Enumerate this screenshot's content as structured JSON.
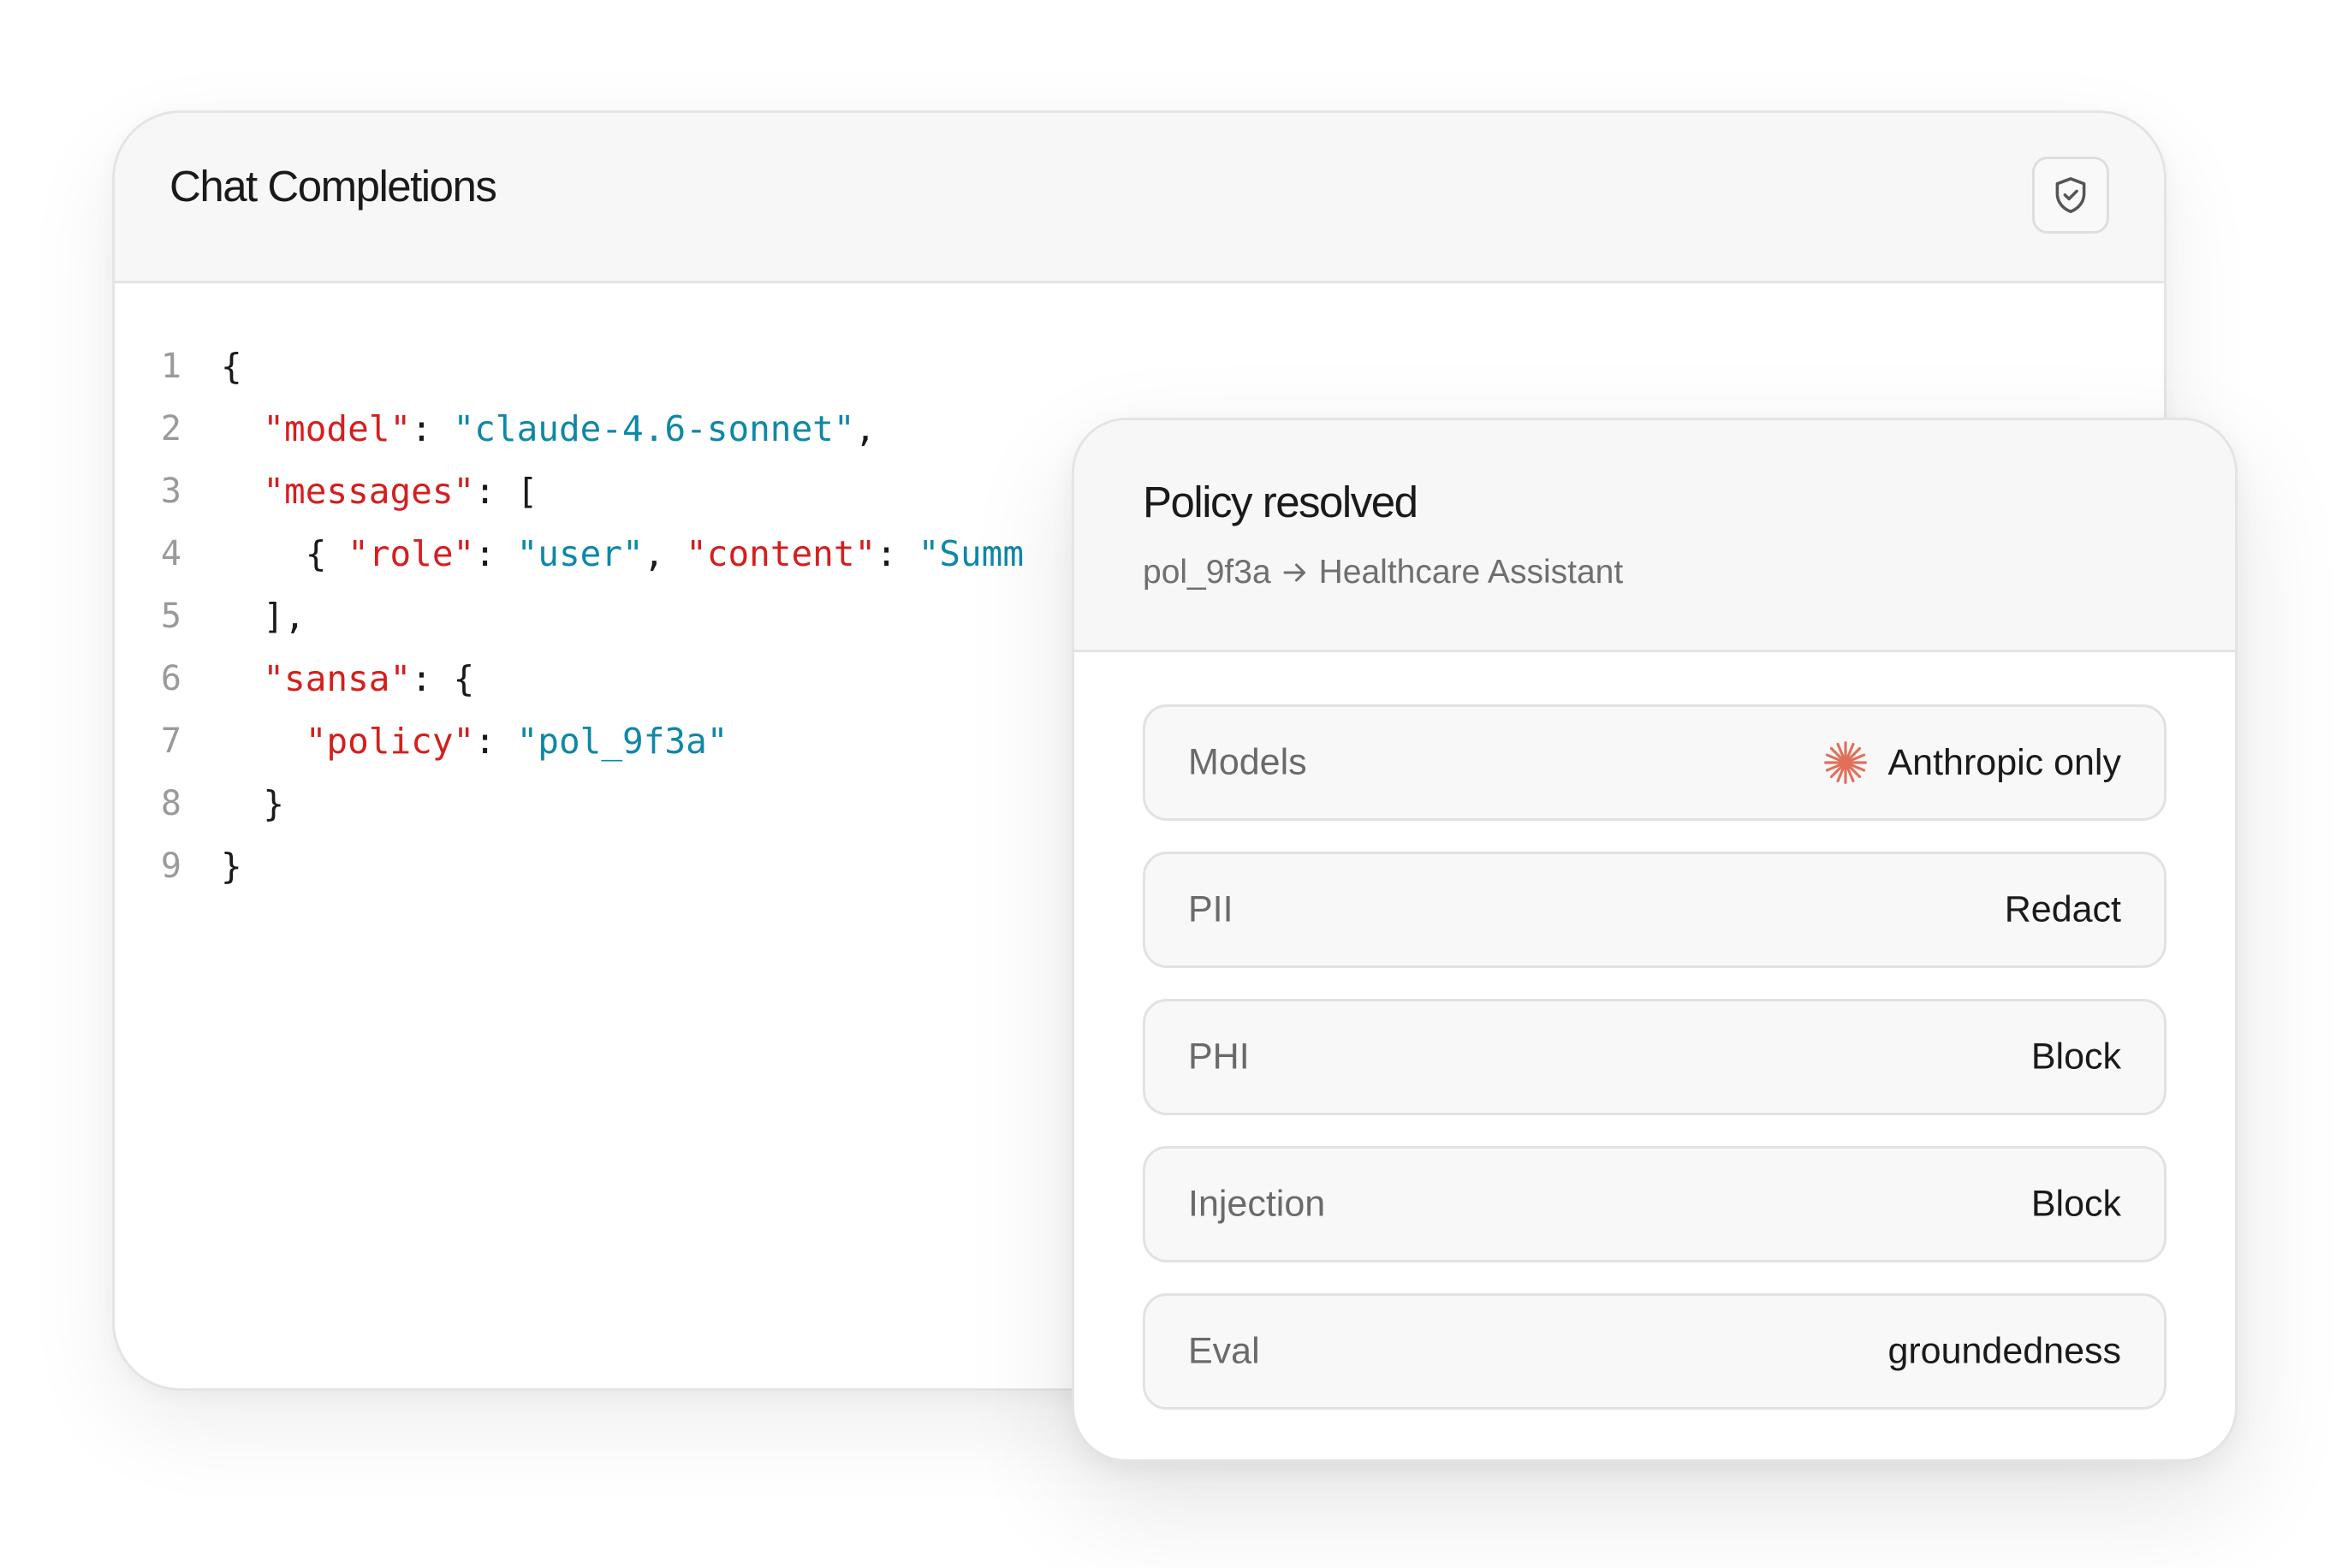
{
  "chat": {
    "title": "Chat Completions",
    "icon": "shield-check-icon",
    "code": {
      "line_numbers": [
        "1",
        "2",
        "3",
        "4",
        "5",
        "6",
        "7",
        "8",
        "9"
      ],
      "lines": [
        [
          {
            "t": "{",
            "k": "punc"
          }
        ],
        [
          {
            "t": "  ",
            "k": "punc"
          },
          {
            "t": "\"model\"",
            "k": "key"
          },
          {
            "t": ": ",
            "k": "punc"
          },
          {
            "t": "\"claude-4.6-sonnet\"",
            "k": "str"
          },
          {
            "t": ",",
            "k": "punc"
          }
        ],
        [
          {
            "t": "  ",
            "k": "punc"
          },
          {
            "t": "\"messages\"",
            "k": "key"
          },
          {
            "t": ": [",
            "k": "punc"
          }
        ],
        [
          {
            "t": "    { ",
            "k": "punc"
          },
          {
            "t": "\"role\"",
            "k": "key"
          },
          {
            "t": ": ",
            "k": "punc"
          },
          {
            "t": "\"user\"",
            "k": "str"
          },
          {
            "t": ", ",
            "k": "punc"
          },
          {
            "t": "\"content\"",
            "k": "key"
          },
          {
            "t": ": ",
            "k": "punc"
          },
          {
            "t": "\"Summ",
            "k": "str"
          }
        ],
        [
          {
            "t": "  ],",
            "k": "punc"
          }
        ],
        [
          {
            "t": "  ",
            "k": "punc"
          },
          {
            "t": "\"sansa\"",
            "k": "key"
          },
          {
            "t": ": {",
            "k": "punc"
          }
        ],
        [
          {
            "t": "    ",
            "k": "punc"
          },
          {
            "t": "\"policy\"",
            "k": "key"
          },
          {
            "t": ": ",
            "k": "punc"
          },
          {
            "t": "\"pol_9f3a\"",
            "k": "str"
          }
        ],
        [
          {
            "t": "  }",
            "k": "punc"
          }
        ],
        [
          {
            "t": "}",
            "k": "punc"
          }
        ]
      ]
    }
  },
  "policy": {
    "title": "Policy resolved",
    "policy_id": "pol_9f3a",
    "arrow_icon": "arrow-right-icon",
    "assistant_name": "Healthcare Assistant",
    "rows": [
      {
        "label": "Models",
        "value": "Anthropic only",
        "icon": "anthropic-icon"
      },
      {
        "label": "PII",
        "value": "Redact"
      },
      {
        "label": "PHI",
        "value": "Block"
      },
      {
        "label": "Injection",
        "value": "Block"
      },
      {
        "label": "Eval",
        "value": "groundedness"
      }
    ]
  },
  "colors": {
    "json_key": "#d41f1f",
    "json_string": "#0e88a7",
    "anthropic_accent": "#e0705a"
  }
}
